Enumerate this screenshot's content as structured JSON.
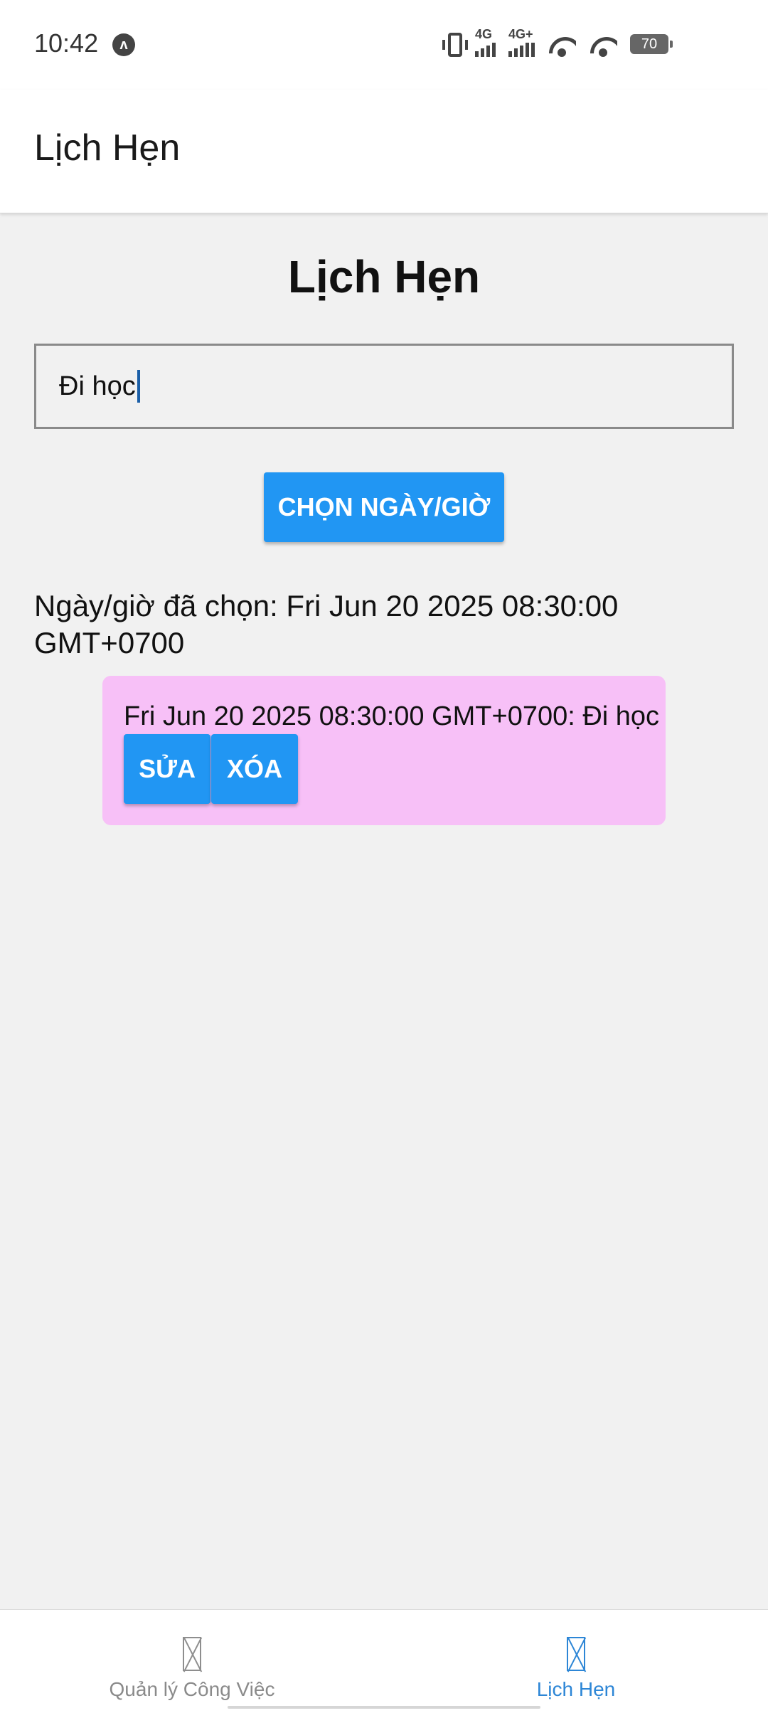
{
  "status_bar": {
    "time": "10:42",
    "app_icon_glyph": "ʌ",
    "network_1_label": "4G",
    "network_2_label": "4G+",
    "battery": "70",
    "icons": [
      "vibrate-icon",
      "signal-4g-icon",
      "signal-4g-plus-icon",
      "wifi-icon",
      "wifi-icon",
      "battery-icon"
    ]
  },
  "header": {
    "title": "Lịch Hẹn"
  },
  "main": {
    "title": "Lịch Hẹn",
    "input_value": "Đi học",
    "pick_button_label": "CHỌN NGÀY/GIỜ",
    "selected_text": "Ngày/giờ đã chọn: Fri Jun 20 2025 08:30:00 GMT+0700",
    "appointments": [
      {
        "text": "Fri Jun 20 2025 08:30:00 GMT+0700: Đi học",
        "edit_label": "SỬA",
        "delete_label": "XÓA"
      }
    ]
  },
  "bottom_nav": {
    "items": [
      {
        "label": "Quản lý Công Việc",
        "icon": "missing-glyph-icon",
        "active": false
      },
      {
        "label": "Lịch Hẹn",
        "icon": "missing-glyph-icon",
        "active": true
      }
    ]
  },
  "colors": {
    "accent": "#2196f3",
    "card_background": "#f7c0f7",
    "page_background": "#f1f1f1",
    "nav_active": "#2d86d6",
    "nav_inactive": "#8a8a8a"
  }
}
